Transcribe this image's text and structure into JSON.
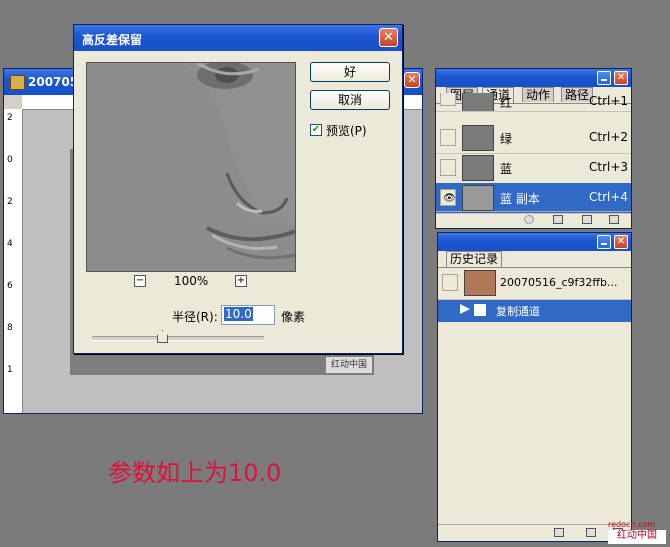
{
  "doc_window": {
    "title": "20070516_c9f32ffb..."
  },
  "ruler_left_numbers": [
    "2",
    "0",
    "2",
    "4",
    "6",
    "8",
    "1"
  ],
  "dialog": {
    "title": "高反差保留",
    "ok_label": "好",
    "cancel_label": "取消",
    "preview_label": "预览(P)",
    "preview_checked": true,
    "zoom": "100%",
    "zoom_out": "−",
    "zoom_in": "+",
    "radius_label": "半径(R):",
    "radius_value": "10.0",
    "radius_unit": "像素",
    "slider_level": 0.42
  },
  "channels_panel": {
    "tabs": [
      "图层",
      "通道",
      "动作",
      "路径"
    ],
    "active_tab": "通道",
    "rows": [
      {
        "name": "红",
        "shortcut": "Ctrl+1",
        "selected": false,
        "visible": false
      },
      {
        "name": "绿",
        "shortcut": "Ctrl+2",
        "selected": false,
        "visible": false
      },
      {
        "name": "蓝",
        "shortcut": "Ctrl+3",
        "selected": false,
        "visible": false
      },
      {
        "name": "蓝 副本",
        "shortcut": "Ctrl+4",
        "selected": true,
        "visible": true
      }
    ]
  },
  "history_panel": {
    "tab": "历史记录",
    "snapshot": "20070516_c9f32ffb...",
    "steps": [
      "复制通道"
    ]
  },
  "caption": "参数如上为10.0",
  "watermark": {
    "doc": "红动中国",
    "site": "redocn.com",
    "brand": "红动中国"
  },
  "colors": {
    "accent": "#3169c6",
    "caption": "#e0103c",
    "titlebar": "#1c57d2"
  }
}
